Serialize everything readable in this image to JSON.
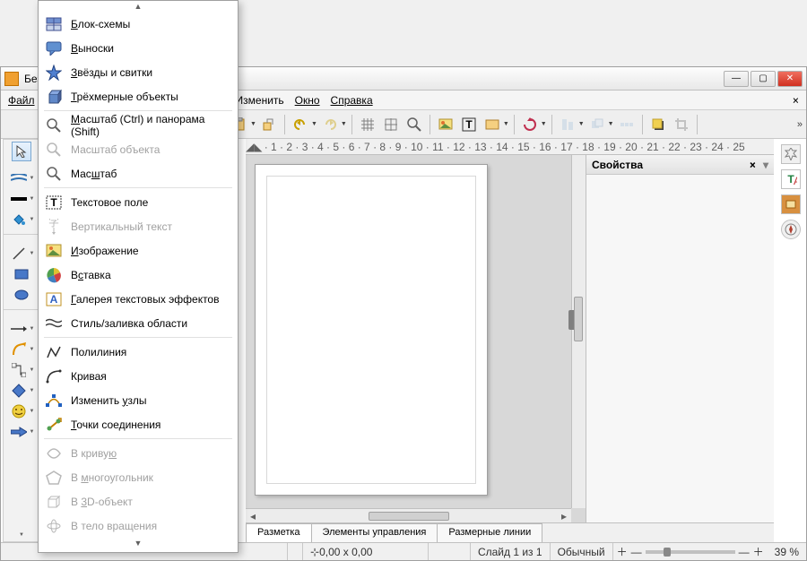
{
  "titlebar": {
    "text": "Без и"
  },
  "menubar": {
    "items": [
      "Файл",
      "Изменить",
      "Окно",
      "Справка"
    ],
    "uindex": [
      0,
      0,
      0,
      0
    ]
  },
  "ruler_h": "· 1 · 2 · 3 · 4 · 5 · 6 · 7 · 8 · 9 · 10 · 11 · 12 · 13 · 14 · 15 · 16 · 17 · 18 · 19 · 20 · 21 · 22 · 23 · 24 · 25",
  "right_panel": {
    "title": "Свойства"
  },
  "bottom_tabs": [
    "Разметка",
    "Элементы управления",
    "Размерные линии"
  ],
  "status": {
    "coord_icon": "⊹",
    "coords": "0,00 x 0,00",
    "slide": "Слайд 1 из 1",
    "mode": "Обычный",
    "zoom": "39 %"
  },
  "popup": {
    "items": [
      {
        "icon": "flowchart",
        "label": "Блок-схемы",
        "u": 0,
        "enabled": true
      },
      {
        "icon": "callout",
        "label": "Выноски",
        "u": 0,
        "enabled": true
      },
      {
        "icon": "star",
        "label": "Звёзды и свитки",
        "u": 0,
        "enabled": true
      },
      {
        "icon": "cube",
        "label": "Трёхмерные объекты",
        "u": 0,
        "enabled": true
      },
      {
        "sep": true
      },
      {
        "icon": "zoompan",
        "label": "Масштаб (Ctrl) и панорама (Shift)",
        "u": 0,
        "enabled": true
      },
      {
        "icon": "zoom",
        "label": "Масштаб объекта",
        "u": -1,
        "enabled": false
      },
      {
        "icon": "zoom",
        "label": "Масштаб",
        "u": 3,
        "enabled": true
      },
      {
        "sep": true
      },
      {
        "icon": "textbox",
        "label": "Текстовое поле",
        "u": -1,
        "enabled": true
      },
      {
        "icon": "vtext",
        "label": "Вертикальный текст",
        "u": -1,
        "enabled": false
      },
      {
        "icon": "image",
        "label": "Изображение",
        "u": 0,
        "enabled": true
      },
      {
        "icon": "pie",
        "label": "Вставка",
        "u": 1,
        "enabled": true
      },
      {
        "icon": "fontwork",
        "label": "Галерея текстовых эффектов",
        "u": 0,
        "enabled": true
      },
      {
        "icon": "fill",
        "label": "Стиль/заливка области",
        "u": -1,
        "enabled": true
      },
      {
        "sep": true
      },
      {
        "icon": "polyline",
        "label": "Полилиния",
        "u": -1,
        "enabled": true
      },
      {
        "icon": "curve",
        "label": "Кривая",
        "u": -1,
        "enabled": true
      },
      {
        "icon": "nodes",
        "label": "Изменить узлы",
        "u": 9,
        "enabled": true
      },
      {
        "icon": "glue",
        "label": "Точки соединения",
        "u": 0,
        "enabled": true
      },
      {
        "sep": true
      },
      {
        "icon": "tocurve",
        "label": "В кривую",
        "u": 7,
        "enabled": false
      },
      {
        "icon": "topoly",
        "label": "В многоугольник",
        "u": 2,
        "enabled": false
      },
      {
        "icon": "to3d",
        "label": "В 3D-объект",
        "u": 2,
        "enabled": false
      },
      {
        "icon": "torot",
        "label": "В тело вращения",
        "u": -1,
        "enabled": false
      }
    ]
  },
  "toolbox": [
    {
      "name": "pointer",
      "sel": true
    },
    {
      "name": "line-style"
    },
    {
      "name": "line-color"
    },
    {
      "name": "fill-bucket"
    },
    {
      "name": "sep"
    },
    {
      "name": "line"
    },
    {
      "name": "rectangle"
    },
    {
      "name": "ellipse"
    },
    {
      "name": "sep"
    },
    {
      "name": "arrow-line"
    },
    {
      "name": "curve-pencil"
    },
    {
      "name": "connector"
    },
    {
      "name": "basic-shapes"
    },
    {
      "name": "smiley"
    },
    {
      "name": "arrows-shape"
    }
  ],
  "rsidebar": [
    "properties",
    "styles",
    "gallery",
    "navigator"
  ]
}
